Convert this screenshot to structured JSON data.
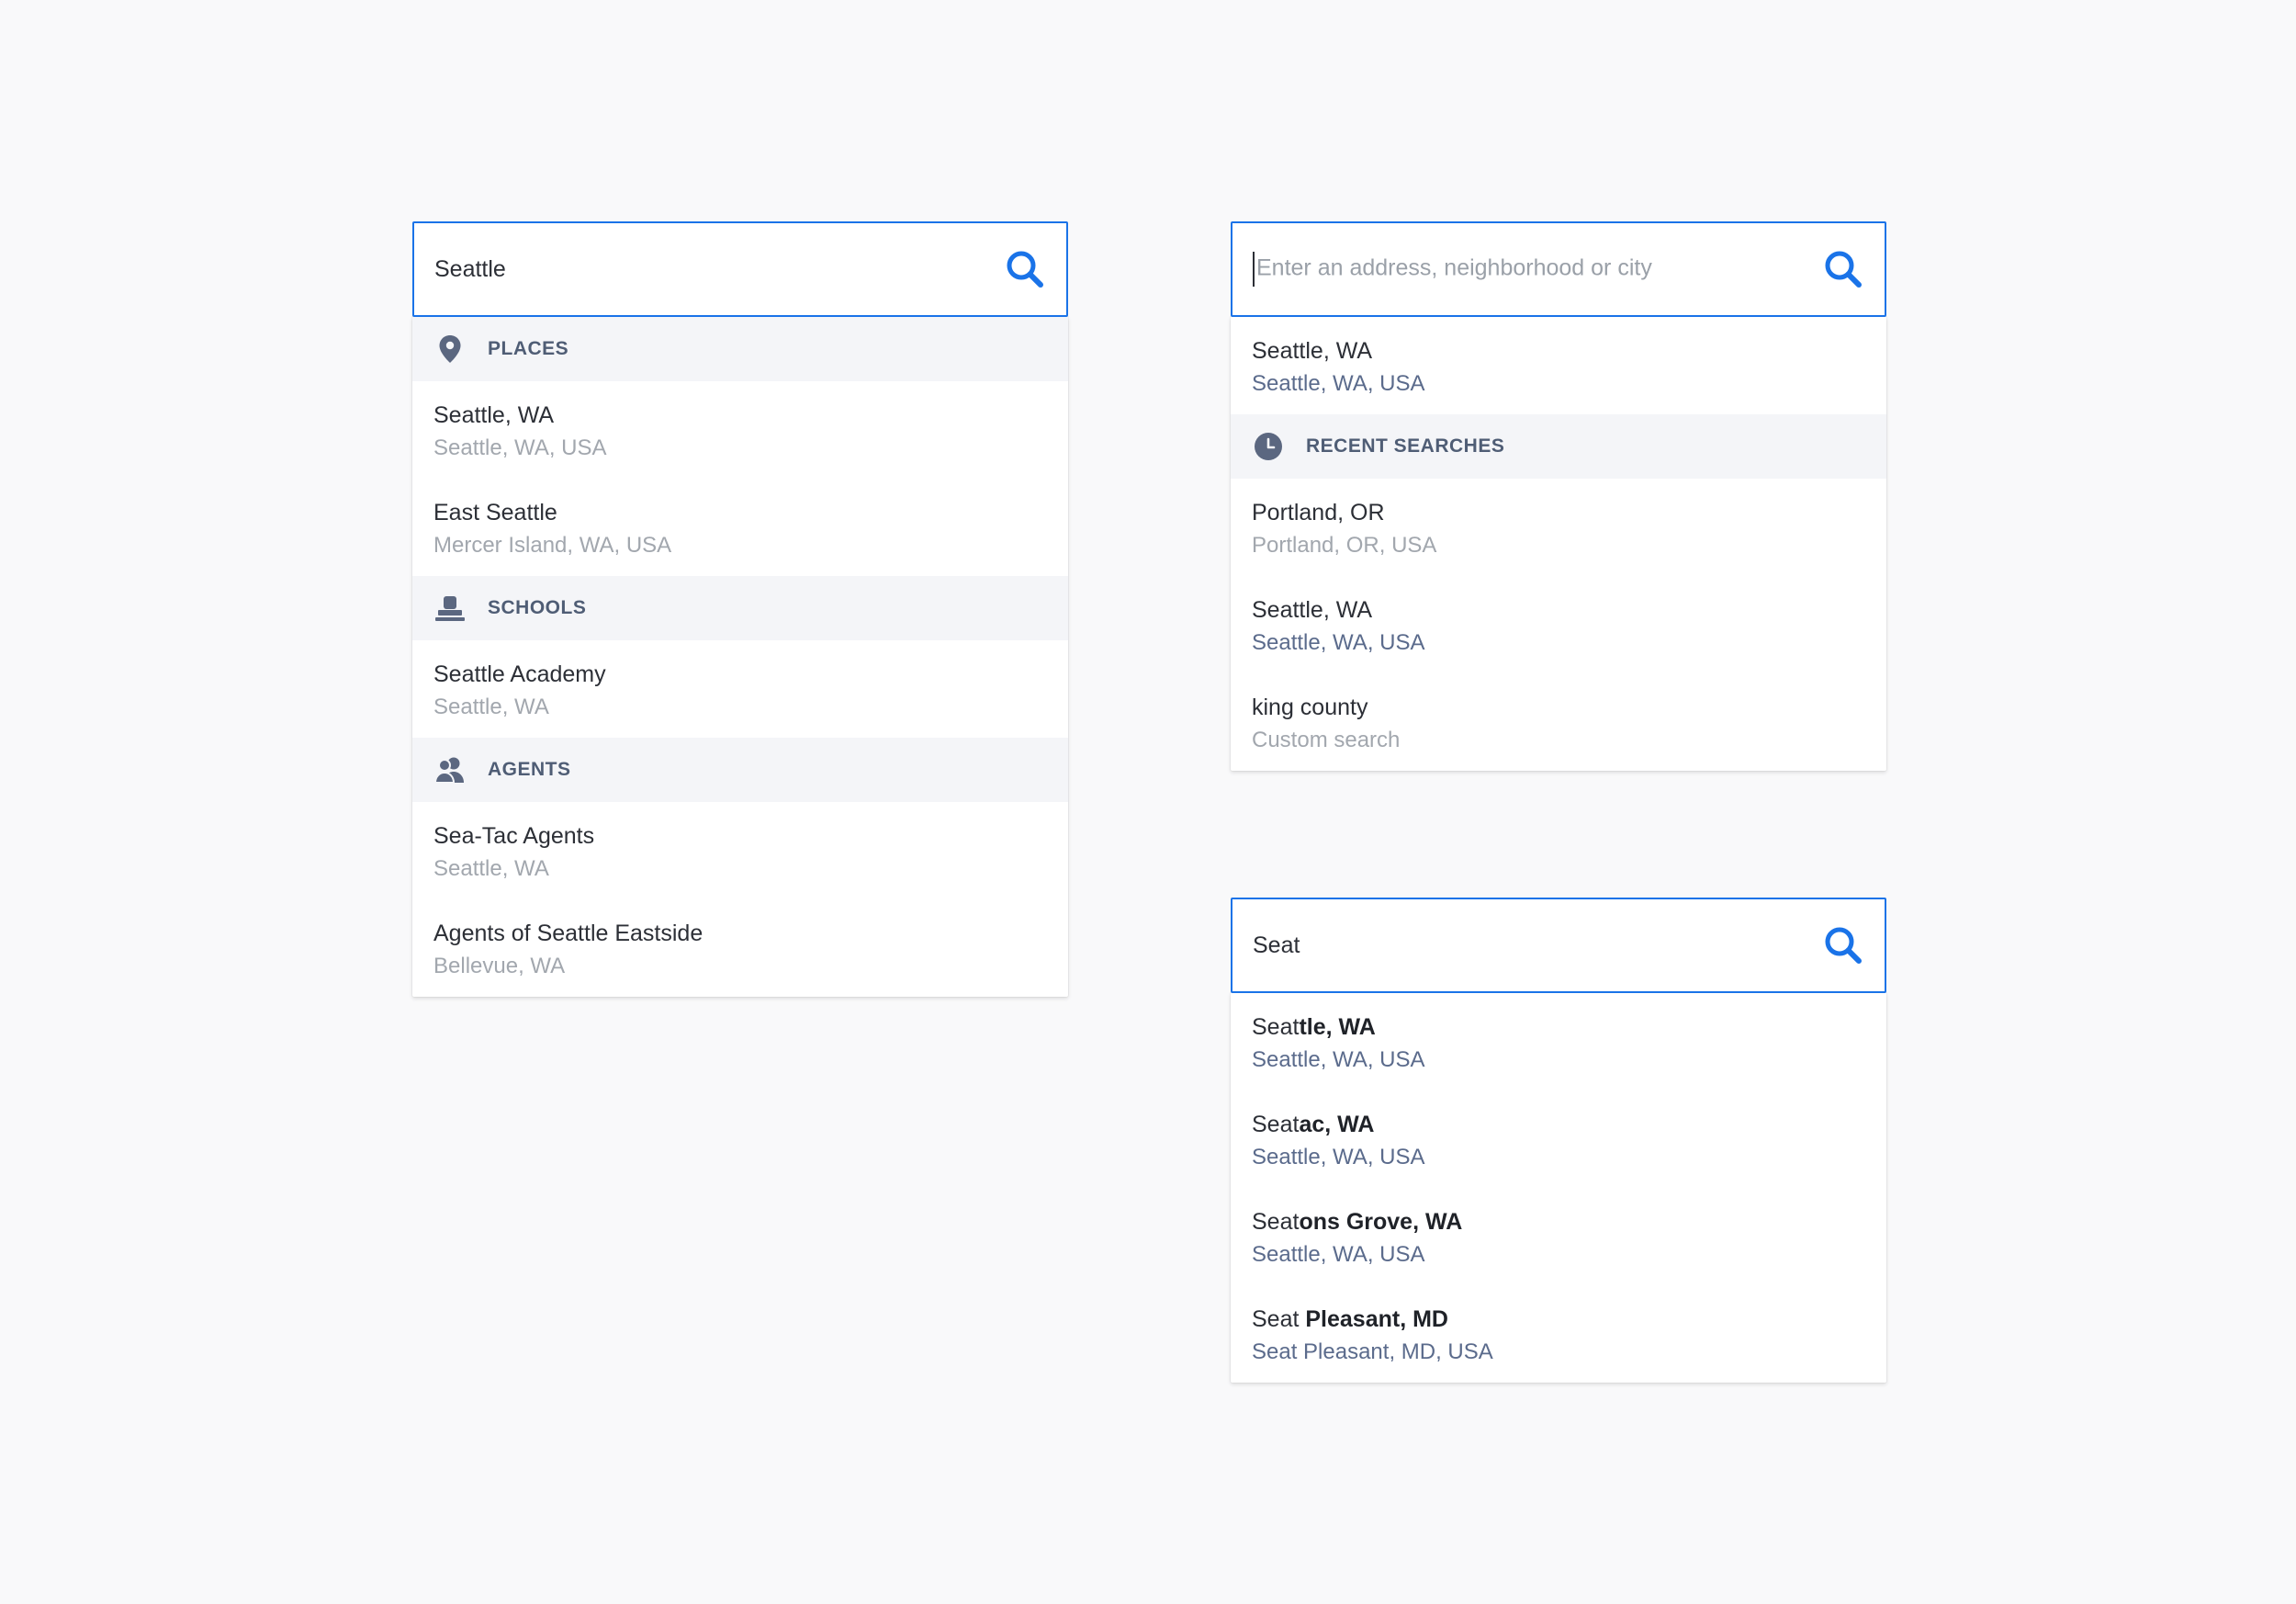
{
  "colors": {
    "accent": "#1a73e8",
    "header_bg": "#f4f5f8",
    "header_text": "#4f5d75"
  },
  "panel1": {
    "search": {
      "value": "Seattle",
      "icon": "search-icon"
    },
    "sections": {
      "places": {
        "title": "PLACES",
        "icon": "map-pin-icon",
        "items": [
          {
            "primary": "Seattle, WA",
            "secondary": "Seattle, WA, USA"
          },
          {
            "primary": "East Seattle",
            "secondary": "Mercer Island, WA, USA"
          }
        ]
      },
      "schools": {
        "title": "SCHOOLS",
        "icon": "school-icon",
        "items": [
          {
            "primary": "Seattle Academy",
            "secondary": "Seattle, WA"
          }
        ]
      },
      "agents": {
        "title": "AGENTS",
        "icon": "agents-icon",
        "items": [
          {
            "primary": "Sea-Tac Agents",
            "secondary": "Seattle, WA"
          },
          {
            "primary": "Agents of Seattle Eastside",
            "secondary": "Bellevue, WA"
          }
        ]
      }
    }
  },
  "panel2": {
    "search": {
      "placeholder": "Enter an address, neighborhood or city",
      "icon": "search-icon"
    },
    "current": {
      "primary": "Seattle, WA",
      "secondary": "Seattle, WA, USA"
    },
    "recent": {
      "title": "RECENT SEARCHES",
      "icon": "clock-icon",
      "items": [
        {
          "primary": "Portland, OR",
          "secondary": "Portland, OR, USA"
        },
        {
          "primary": "Seattle, WA",
          "secondary": "Seattle, WA, USA"
        },
        {
          "primary": "king county",
          "secondary": "Custom search"
        }
      ]
    }
  },
  "panel3": {
    "search": {
      "value": "Seat",
      "icon": "search-icon"
    },
    "suggestions": [
      {
        "match": "Seat",
        "rest": "tle, WA",
        "secondary": "Seattle, WA, USA"
      },
      {
        "match": "Seat",
        "rest": "ac, WA",
        "secondary": "Seattle, WA, USA"
      },
      {
        "match": "Seat",
        "rest": "ons Grove, WA",
        "secondary": "Seattle, WA, USA"
      },
      {
        "match": "Seat ",
        "rest": "Pleasant, MD",
        "secondary": "Seat Pleasant, MD, USA"
      }
    ]
  }
}
